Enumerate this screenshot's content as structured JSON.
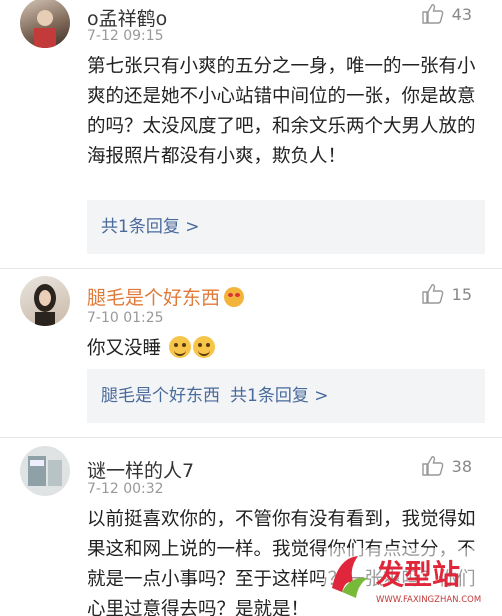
{
  "comments": [
    {
      "username": "o孟祥鹤o",
      "time": "7-12 09:15",
      "likes": "43",
      "text": "第七张只有小爽的五分之一身，唯一的一张有小爽的还是她不小心站错中间位的一张，你是故意的吗？太没风度了吧，和余文乐两个大男人放的海报照片都没有小爽，欺负人！",
      "reply_label": "共1条回复 >"
    },
    {
      "username": "腿毛是个好东西",
      "time": "7-10 01:25",
      "likes": "15",
      "text": "你又没睡",
      "reply_name": "腿毛是个好东西",
      "reply_label": "共1条回复 >"
    },
    {
      "username": "谜一样的人7",
      "time": "7-12 00:32",
      "likes": "38",
      "text": "以前挺喜欢你的，不管你有没有看到，我觉得如果这和网上说的一样。我觉得你们有点过分，不就是一点小事吗？至于这样吗？一张爽吗？你们心里过意得去吗？是就是！"
    }
  ],
  "watermark": {
    "text": "发型站",
    "url": "WWW.FAXINGZHAN.COM"
  },
  "colors": {
    "link": "#4a6a9c",
    "orange_name": "#e07a3a",
    "reply_bg": "#f3f4f6"
  }
}
